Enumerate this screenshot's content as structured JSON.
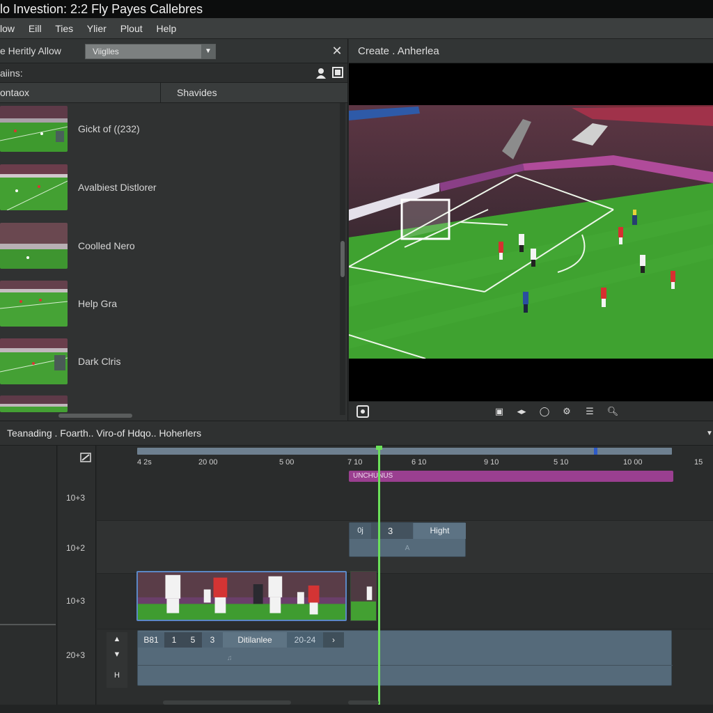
{
  "app": {
    "window_title": "lo Investion: 2:2  Fly Payes Callebres"
  },
  "menu": [
    "low",
    "Eill",
    "Ties",
    "Ylier",
    "Plout",
    "Help"
  ],
  "browser_panel": {
    "title": "e  Heritly Allow",
    "select_value": "Viiglles",
    "sub_heading": "aiins:",
    "columns": [
      "ontaox",
      "Shavides"
    ],
    "clips": [
      {
        "label": "Gickt of ((232)"
      },
      {
        "label": "Avalbiest Distlorer"
      },
      {
        "label": "Coolled Nero"
      },
      {
        "label": "Help Gra"
      },
      {
        "label": "Dark Clris"
      }
    ]
  },
  "viewer": {
    "title": "Create . Anherlea"
  },
  "timeline": {
    "title": "Teanading . Foarth..  Viro-of Hdqo..  Hoherlers",
    "ruler_labels": [
      "4 2s",
      "20 00",
      "5 00",
      "7 10",
      "6 10",
      "9 10",
      "5 10",
      "10 00",
      "15"
    ],
    "track_labels": [
      "10+3",
      "10+2",
      "10+3",
      "20+3"
    ],
    "magenta_clip_label": "UNCHUNUS",
    "clip2": {
      "a": "0j",
      "b": "3",
      "c": "Hight",
      "d": "A"
    },
    "audio_row": [
      "B81",
      "1",
      "5",
      "3",
      "Ditilanlee",
      "20-24",
      "›"
    ],
    "lane4_controls": [
      "▲",
      "▼",
      "H"
    ]
  },
  "colors": {
    "accent_magenta": "#9a3f90",
    "playhead_green": "#6be05a",
    "clip_blue": "#556a7a",
    "ruler_mark_blue": "#2c5ac8"
  },
  "icons": [
    "user-icon",
    "view-icon",
    "close-icon",
    "dropdown-arrow-icon",
    "snapshot-icon",
    "caption-icon",
    "audio-icon",
    "loop-icon",
    "settings-icon",
    "list-icon",
    "search-icon",
    "trim-icon"
  ]
}
